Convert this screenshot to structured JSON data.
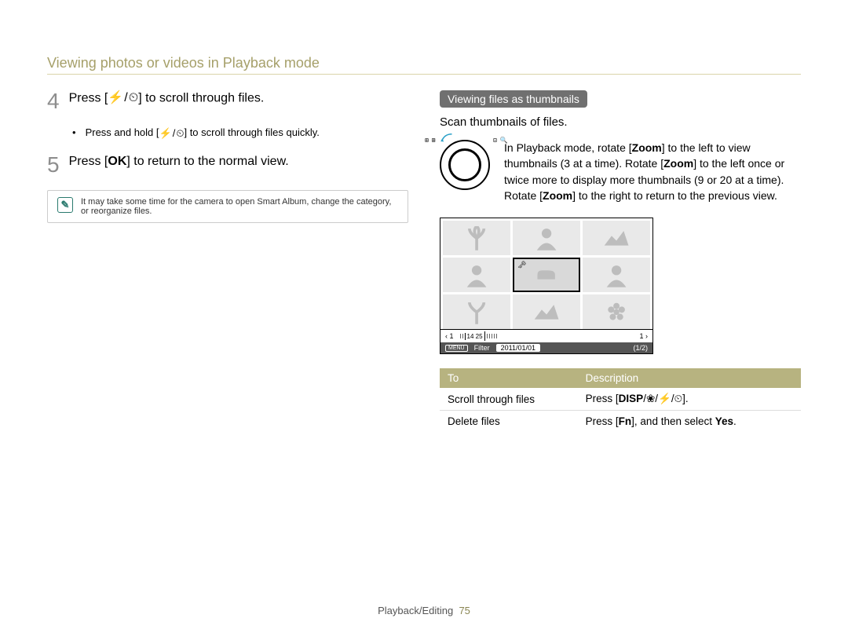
{
  "header": {
    "title": "Viewing photos or videos in Playback mode"
  },
  "left": {
    "step4_num": "4",
    "step4_text_pre": "Press [",
    "step4_flash": "⚡",
    "step4_sep": "/",
    "step4_timer": "⏲",
    "step4_text_post": "] to scroll through files.",
    "step4_bullet_pre": "Press and hold [",
    "step4_bullet_post": "] to scroll through files quickly.",
    "step5_num": "5",
    "step5_text_pre": "Press [",
    "step5_ok": "OK",
    "step5_text_post": "] to return to the normal view.",
    "note_icon": "✎",
    "note_text": "It may take some time for the camera to open Smart Album, change the category, or reorganize files."
  },
  "right": {
    "heading": "Viewing files as thumbnails",
    "lead": "Scan thumbnails of files.",
    "dial_left": "⊞ ⊞",
    "dial_right": "⊡ 🔍",
    "para_pre": "In Playback mode, rotate [",
    "zoom": "Zoom",
    "para_mid1": "] to the left to view thumbnails (3 at a time). Rotate [",
    "para_mid2": "] to the left once or twice more to display more thumbnails (9 or 20 at a time). Rotate [",
    "para_post": "] to the right to return to the previous view.",
    "screen": {
      "bar1_left": "‹   1",
      "bar1_mid": "14 25",
      "bar1_right": "1   ›",
      "bar2_menu": "MENU",
      "bar2_filter": "Filter",
      "bar2_date": "2011/01/01",
      "bar2_pages": "(1/2)"
    },
    "table": {
      "h1": "To",
      "h2": "Description",
      "r1c1": "Scroll through files",
      "r1c2_pre": "Press [",
      "r1c2_disp": "DISP",
      "r1c2_sep1": "/",
      "r1c2_macro": "❀",
      "r1c2_sep2": "/",
      "r1c2_flash": "⚡",
      "r1c2_sep3": "/",
      "r1c2_timer": "⏲",
      "r1c2_post": "].",
      "r2c1": "Delete files",
      "r2c2_pre": "Press [",
      "r2c2_fn": "Fn",
      "r2c2_mid": "], and then select ",
      "r2c2_yes": "Yes",
      "r2c2_post": "."
    }
  },
  "footer": {
    "section": "Playback/Editing",
    "page": "75"
  }
}
